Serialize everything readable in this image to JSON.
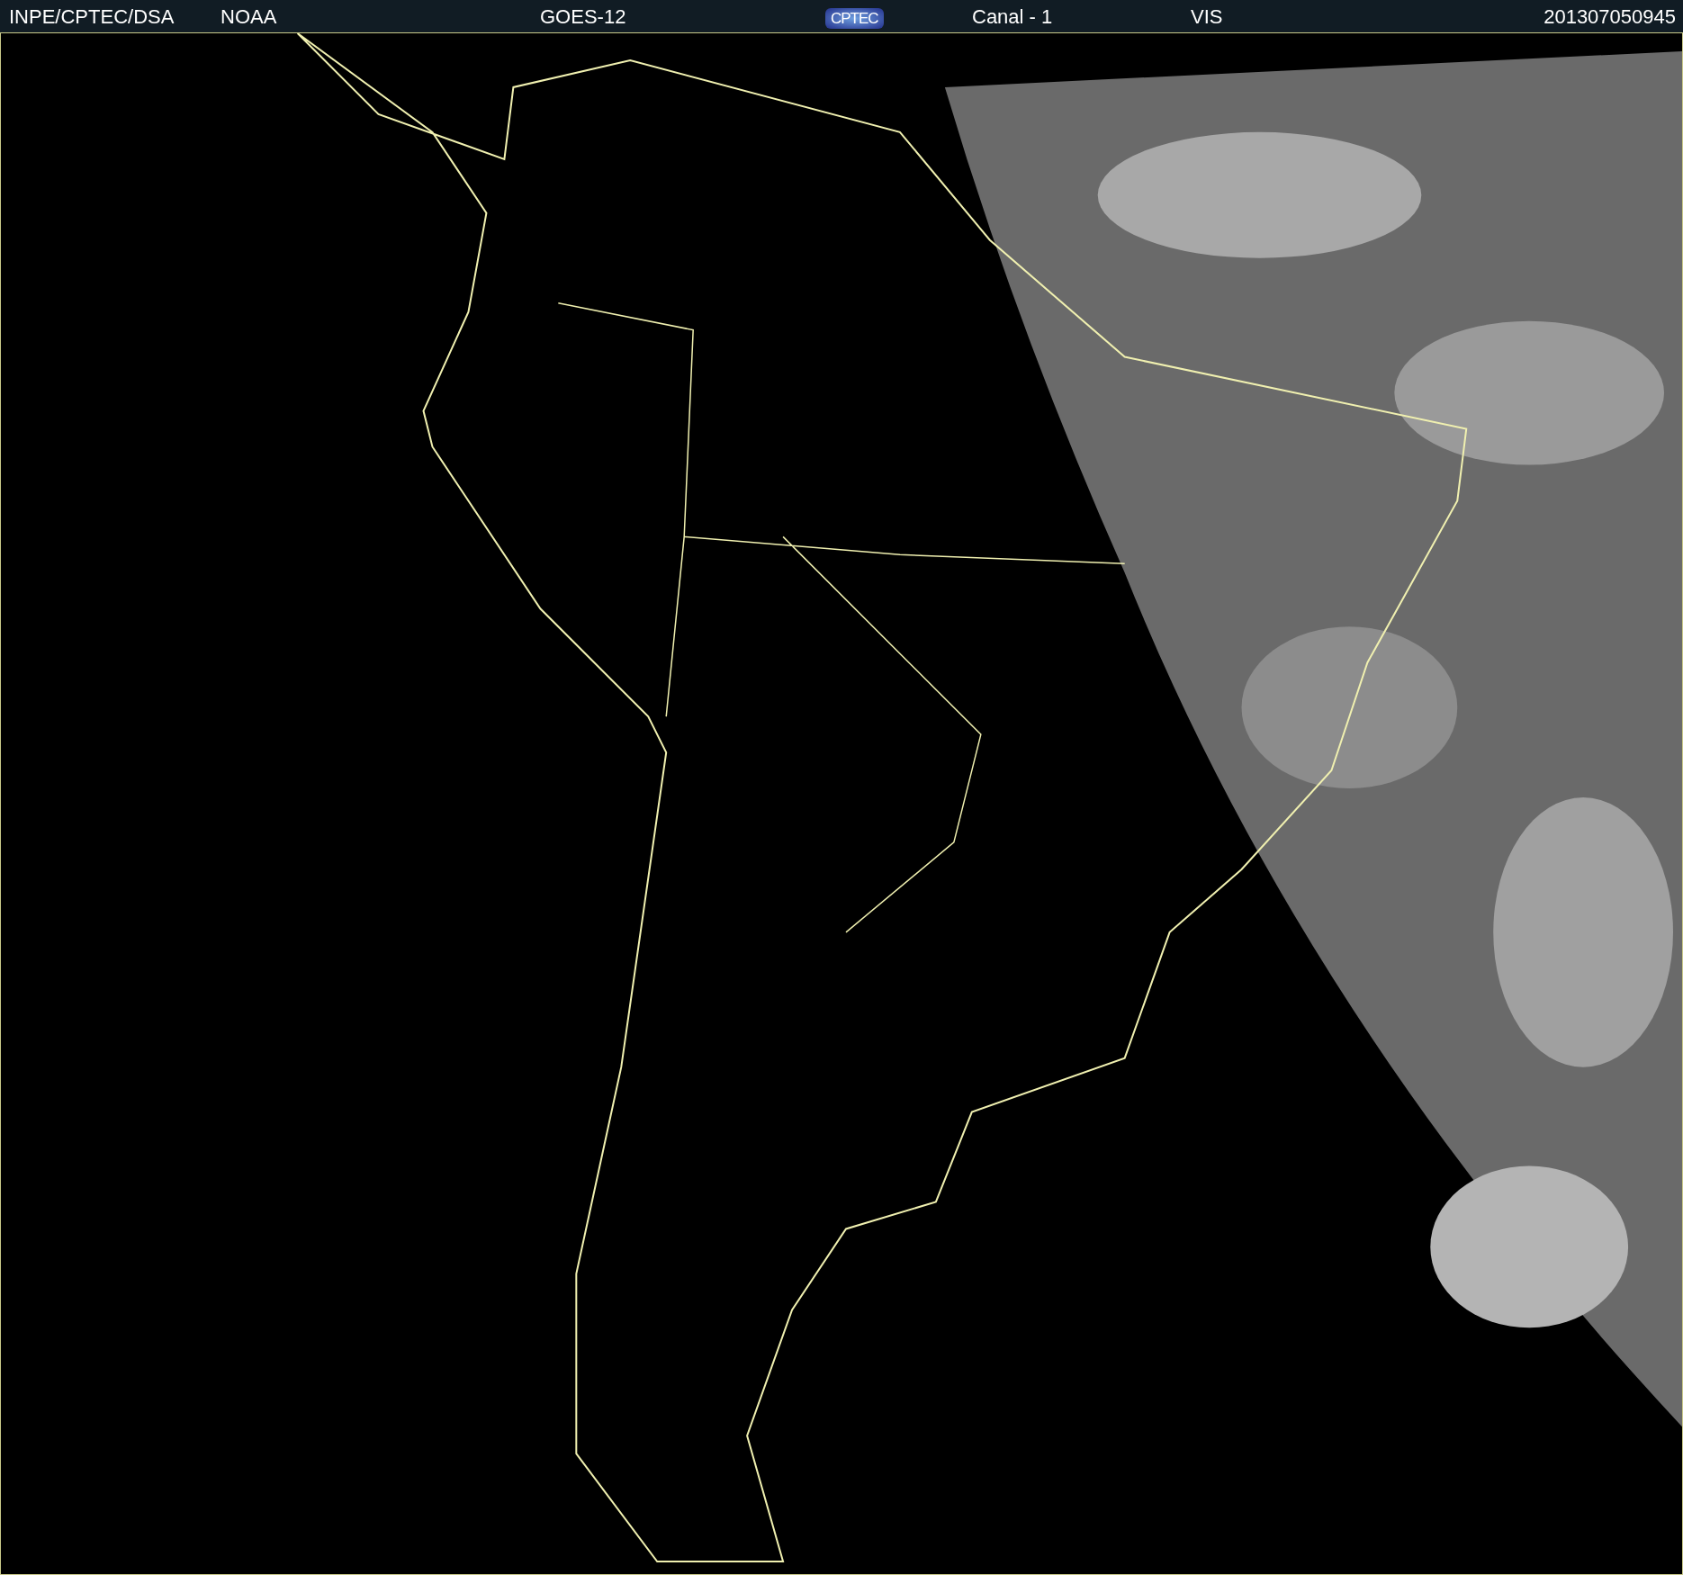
{
  "header": {
    "items": [
      {
        "kind": "text",
        "text": "INPE/CPTEC/DSA"
      },
      {
        "kind": "text",
        "text": "NOAA"
      },
      {
        "kind": "text",
        "text": "GOES-12"
      },
      {
        "kind": "logo",
        "text": "CPTEC"
      },
      {
        "kind": "text",
        "text": "Canal - 1"
      },
      {
        "kind": "text",
        "text": "VIS"
      },
      {
        "kind": "date",
        "text": "201307050945"
      }
    ]
  }
}
